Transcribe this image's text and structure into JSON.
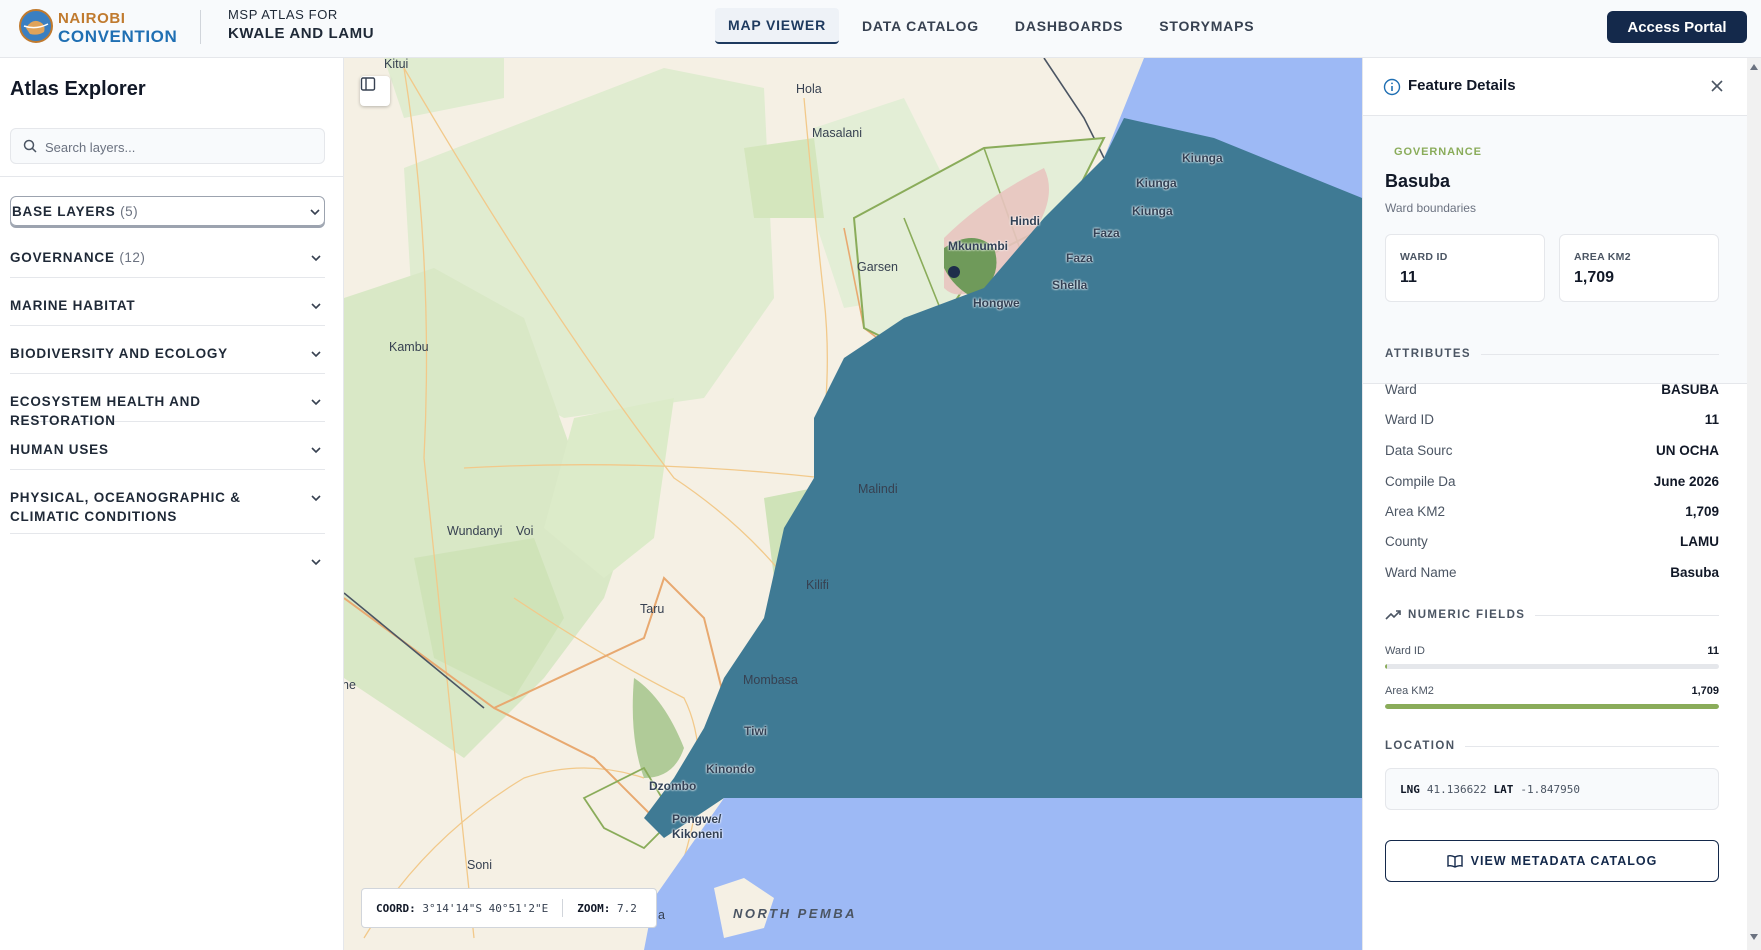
{
  "header": {
    "brand_line1": "NAIROBI",
    "brand_line2": "CONVENTION",
    "atlas_line1": "MSP ATLAS FOR",
    "atlas_line2": "KWALE AND LAMU",
    "nav": [
      {
        "label": "MAP VIEWER",
        "active": true
      },
      {
        "label": "DATA CATALOG",
        "active": false
      },
      {
        "label": "DASHBOARDS",
        "active": false
      },
      {
        "label": "STORYMAPS",
        "active": false
      }
    ],
    "portal_label": "Access Portal"
  },
  "sidebar": {
    "title": "Atlas Explorer",
    "search_placeholder": "Search layers...",
    "sections": [
      {
        "label": "BASE LAYERS",
        "count": "(5)"
      },
      {
        "label": "GOVERNANCE",
        "count": "(12)"
      },
      {
        "label": "MARINE HABITAT",
        "count": ""
      },
      {
        "label": "BIODIVERSITY AND ECOLOGY",
        "count": ""
      },
      {
        "label": "ECOSYSTEM HEALTH AND RESTORATION",
        "count": ""
      },
      {
        "label": "HUMAN USES",
        "count": ""
      },
      {
        "label": "PHYSICAL, OCEANOGRAPHIC & CLIMATIC CONDITIONS",
        "count": ""
      },
      {
        "label": "",
        "count": ""
      }
    ]
  },
  "map": {
    "coord_label": "COORD:",
    "coord_value": "3°14'14\"S 40°51'2\"E",
    "zoom_label": "ZOOM:",
    "zoom_value": "7.2",
    "places": {
      "kitui": "Kitui",
      "hola": "Hola",
      "masalani": "Masalani",
      "garsen": "Garsen",
      "kambu": "Kambu",
      "malindi": "Malindi",
      "kilifi": "Kilifi",
      "wundanyi": "Wundanyi",
      "voi": "Voi",
      "taru": "Taru",
      "mombasa": "Mombasa",
      "tiwi": "Tiwi",
      "kinondo": "Kinondo",
      "dzombo": "Dzombo",
      "pongwe": "Pongwe/",
      "kikoneni": "Kikoneni",
      "soni": "Soni",
      "ne": "ne",
      "a": "a",
      "north_pemba": "NORTH PEMBA",
      "kiunga1": "Kiunga",
      "kiunga2": "Kiunga",
      "kiunga3": "Kiunga",
      "hindi": "Hindi",
      "mkunumbi": "Mkunumbi",
      "faza1": "Faza",
      "faza2": "Faza",
      "hongwe": "Hongwe",
      "shella": "Shella"
    },
    "colors": {
      "ocean_shelf": "#3f7a94",
      "deep_sea": "#9db9f5",
      "land": "#f5f0e4",
      "green_area": "#d8e8c4"
    }
  },
  "panel": {
    "title": "Feature Details",
    "category": "GOVERNANCE",
    "feature_name": "Basuba",
    "feature_subtitle": "Ward boundaries",
    "cards": [
      {
        "label": "WARD ID",
        "value": "11"
      },
      {
        "label": "AREA KM2",
        "value": "1,709"
      }
    ],
    "attributes_heading": "ATTRIBUTES",
    "attributes": [
      {
        "key": "Ward",
        "value": "BASUBA"
      },
      {
        "key": "Ward ID",
        "value": "11"
      },
      {
        "key": "Data Sourc",
        "value": "UN OCHA"
      },
      {
        "key": "Compile Da",
        "value": "June 2026"
      },
      {
        "key": "Area KM2",
        "value": "1,709"
      },
      {
        "key": "County",
        "value": "LAMU"
      },
      {
        "key": "Ward Name",
        "value": "Basuba"
      }
    ],
    "numeric_heading": "NUMERIC FIELDS",
    "numeric": [
      {
        "key": "Ward ID",
        "value": "11",
        "fraction": 0.006
      },
      {
        "key": "Area KM2",
        "value": "1,709",
        "fraction": 1.0
      }
    ],
    "location_heading": "LOCATION",
    "lng_label": "LNG",
    "lng_value": "41.136622",
    "lat_label": "LAT",
    "lat_value": "-1.847950",
    "metadata_button": "VIEW METADATA CATALOG",
    "accent_color": "#8aac5a"
  }
}
